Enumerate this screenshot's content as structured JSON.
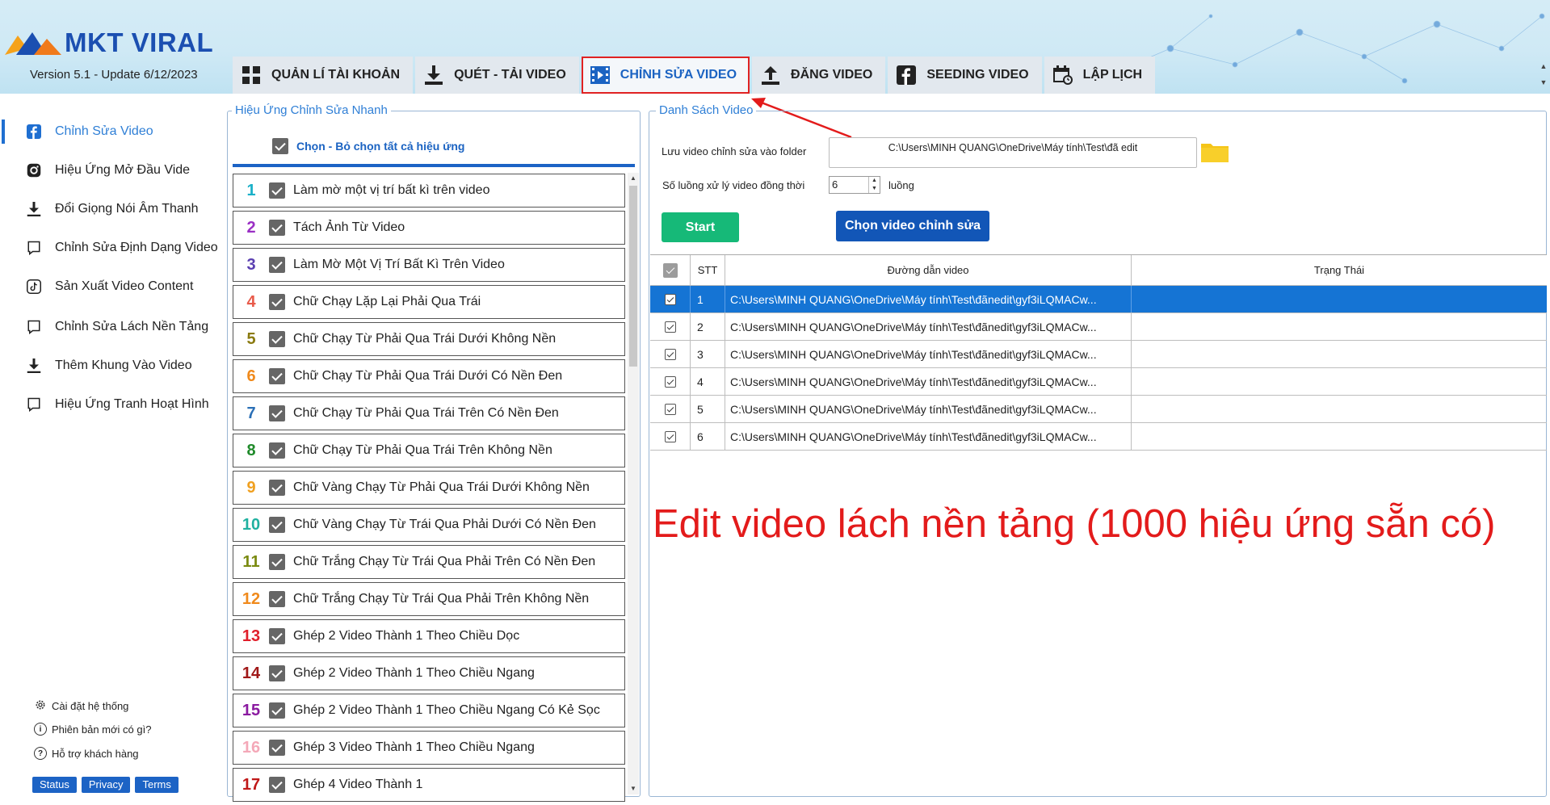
{
  "app": {
    "logo_text": "MKT VIRAL",
    "version": "Version  5.1 - Update  6/12/2023"
  },
  "tabs": [
    {
      "label": "QUẢN LÍ TÀI KHOẢN",
      "icon": "grid-icon",
      "active": false
    },
    {
      "label": "QUÉT - TẢI VIDEO",
      "icon": "download-icon",
      "active": false
    },
    {
      "label": "CHỈNH SỬA VIDEO",
      "icon": "film-play-icon",
      "active": true
    },
    {
      "label": "ĐĂNG VIDEO",
      "icon": "upload-icon",
      "active": false
    },
    {
      "label": "SEEDING VIDEO",
      "icon": "facebook-icon",
      "active": false
    },
    {
      "label": "LẬP LỊCH",
      "icon": "calendar-clock-icon",
      "active": false
    }
  ],
  "sidebar": {
    "items": [
      {
        "label": "Chỉnh Sửa Video",
        "icon": "facebook-icon"
      },
      {
        "label": "Hiệu Ứng Mở Đầu Vide",
        "icon": "instagram-icon"
      },
      {
        "label": "Đổi Giọng Nói Âm Thanh",
        "icon": "download-icon"
      },
      {
        "label": "Chỉnh Sửa Định Dạng Video",
        "icon": "chat-bubble-icon"
      },
      {
        "label": "Sản Xuất Video Content",
        "icon": "tiktok-icon"
      },
      {
        "label": "Chỉnh Sửa Lách Nền Tảng",
        "icon": "chat-bubble-icon"
      },
      {
        "label": "Thêm Khung Vào Video",
        "icon": "download-icon"
      },
      {
        "label": "Hiệu Ứng Tranh Hoạt Hình",
        "icon": "chat-bubble-icon"
      }
    ],
    "bottom": [
      {
        "label": "Cài đặt hệ thống",
        "icon": "gear-icon"
      },
      {
        "label": "Phiên bản mới có gì?",
        "icon": "info-icon"
      },
      {
        "label": "Hỗ trợ khách hàng",
        "icon": "help-chat-icon"
      }
    ],
    "chips": [
      "Status",
      "Privacy",
      "Terms"
    ]
  },
  "effects_panel": {
    "title": "Hiệu Ứng Chỉnh Sửa Nhanh",
    "select_all": "Chọn - Bỏ chọn tất cả hiệu ứng",
    "items": [
      {
        "num": "1",
        "label": "Làm mờ một vị trí bất kì trên video",
        "color": "#19b0c8"
      },
      {
        "num": "2",
        "label": "Tách Ảnh Từ Video",
        "color": "#9a2fc4"
      },
      {
        "num": "3",
        "label": "Làm Mờ Một Vị Trí Bất Kì Trên Video",
        "color": "#5a3fb0"
      },
      {
        "num": "4",
        "label": "Chữ Chạy Lặp Lại Phải Qua Trái",
        "color": "#e85a4a"
      },
      {
        "num": "5",
        "label": "Chữ Chạy Từ Phải Qua Trái Dưới Không Nền",
        "color": "#8a7a10"
      },
      {
        "num": "6",
        "label": "Chữ Chạy Từ Phải Qua Trái Dưới Có Nền Đen",
        "color": "#f08a1c"
      },
      {
        "num": "7",
        "label": "Chữ Chạy Từ Phải Qua Trái Trên Có Nền Đen",
        "color": "#2a6fb6"
      },
      {
        "num": "8",
        "label": "Chữ Chạy Từ Phải Qua Trái Trên Không Nền",
        "color": "#1f8a2a"
      },
      {
        "num": "9",
        "label": "Chữ Vàng Chạy Từ Phải Qua Trái Dưới Không Nền",
        "color": "#f0a020"
      },
      {
        "num": "10",
        "label": "Chữ Vàng Chạy Từ  Trái Qua Phải Dưới Có Nền Đen",
        "color": "#1fb0a0"
      },
      {
        "num": "11",
        "label": "Chữ Trắng Chạy Từ Trái Qua Phải Trên Có Nền Đen",
        "color": "#7a8a10"
      },
      {
        "num": "12",
        "label": "Chữ Trắng Chạy Từ Trái Qua Phải Trên Không Nền",
        "color": "#f08a1c"
      },
      {
        "num": "13",
        "label": "Ghép 2 Video Thành 1 Theo Chiều Dọc",
        "color": "#e01e2a"
      },
      {
        "num": "14",
        "label": "Ghép 2 Video Thành 1 Theo Chiều Ngang",
        "color": "#a01818"
      },
      {
        "num": "15",
        "label": "Ghép 2 Video Thành 1 Theo Chiều Ngang Có Kẻ Sọc",
        "color": "#8a1aa0"
      },
      {
        "num": "16",
        "label": "Ghép 3 Video Thành 1 Theo Chiều Ngang",
        "color": "#f4a8b8"
      },
      {
        "num": "17",
        "label": "Ghép 4 Video Thành 1",
        "color": "#c01818"
      }
    ]
  },
  "video_panel": {
    "title": "Danh Sách Video",
    "save_label": "Lưu video chỉnh sửa vào folder",
    "save_path": "C:\\Users\\MINH QUANG\\OneDrive\\Máy tính\\Test\\đã edit",
    "threads_label": "Số luồng xử lý video đồng thời",
    "threads_value": "6",
    "threads_unit": "luồng",
    "start_label": "Start",
    "choose_label": "Chọn video chỉnh sửa",
    "columns": [
      "STT",
      "Đường dẫn video",
      "Trạng Thái"
    ],
    "rows": [
      {
        "stt": "1",
        "path": "C:\\Users\\MINH QUANG\\OneDrive\\Máy tính\\Test\\đãnedit\\gyf3iLQMACw...",
        "status": "",
        "selected": true
      },
      {
        "stt": "2",
        "path": "C:\\Users\\MINH QUANG\\OneDrive\\Máy tính\\Test\\đãnedit\\gyf3iLQMACw...",
        "status": "",
        "selected": false
      },
      {
        "stt": "3",
        "path": "C:\\Users\\MINH QUANG\\OneDrive\\Máy tính\\Test\\đãnedit\\gyf3iLQMACw...",
        "status": "",
        "selected": false
      },
      {
        "stt": "4",
        "path": "C:\\Users\\MINH QUANG\\OneDrive\\Máy tính\\Test\\đãnedit\\gyf3iLQMACw...",
        "status": "",
        "selected": false
      },
      {
        "stt": "5",
        "path": "C:\\Users\\MINH QUANG\\OneDrive\\Máy tính\\Test\\đãnedit\\gyf3iLQMACw...",
        "status": "",
        "selected": false
      },
      {
        "stt": "6",
        "path": "C:\\Users\\MINH QUANG\\OneDrive\\Máy tính\\Test\\đãnedit\\gyf3iLQMACw...",
        "status": "",
        "selected": false
      }
    ]
  },
  "overlay": {
    "caption": "Edit video lách nền tảng (1000 hiệu ứng sẵn có)",
    "color": "#e31b1b"
  }
}
